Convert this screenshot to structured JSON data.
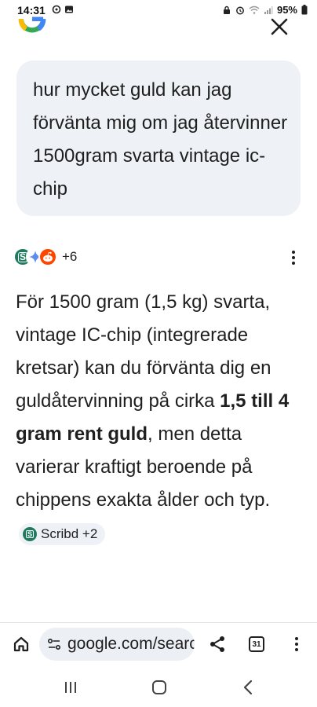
{
  "status_bar": {
    "time": "14:31",
    "battery": "95%"
  },
  "header": {
    "logo_icon": "google-g-logo",
    "close_icon": "close-icon"
  },
  "query": {
    "text": "hur mycket guld kan jag förvänta mig om jag återvinner 1500gram svarta vintage ic-chip"
  },
  "sources": {
    "count_label": "+6",
    "icons": [
      "scribd-icon",
      "gemini-sparkle-icon",
      "reddit-icon"
    ]
  },
  "answer": {
    "part1": "För 1500 gram (1,5 kg) svarta, vintage IC-chip (integrerade kretsar) kan du förvänta dig en guldåtervinning på cirka ",
    "bold": "1,5 till 4 gram rent guld",
    "part2": ", men detta varierar kraftigt beroende på chippens exakta ålder och typ.",
    "chip_label": "Scribd +2"
  },
  "toolbar": {
    "url": "google.com/search",
    "tab_count": "31"
  },
  "colors": {
    "bubble_bg": "#eef1f5",
    "text": "#1f1f1f",
    "scribd_green": "#1e7b5e",
    "reddit_orange": "#ff4500"
  }
}
